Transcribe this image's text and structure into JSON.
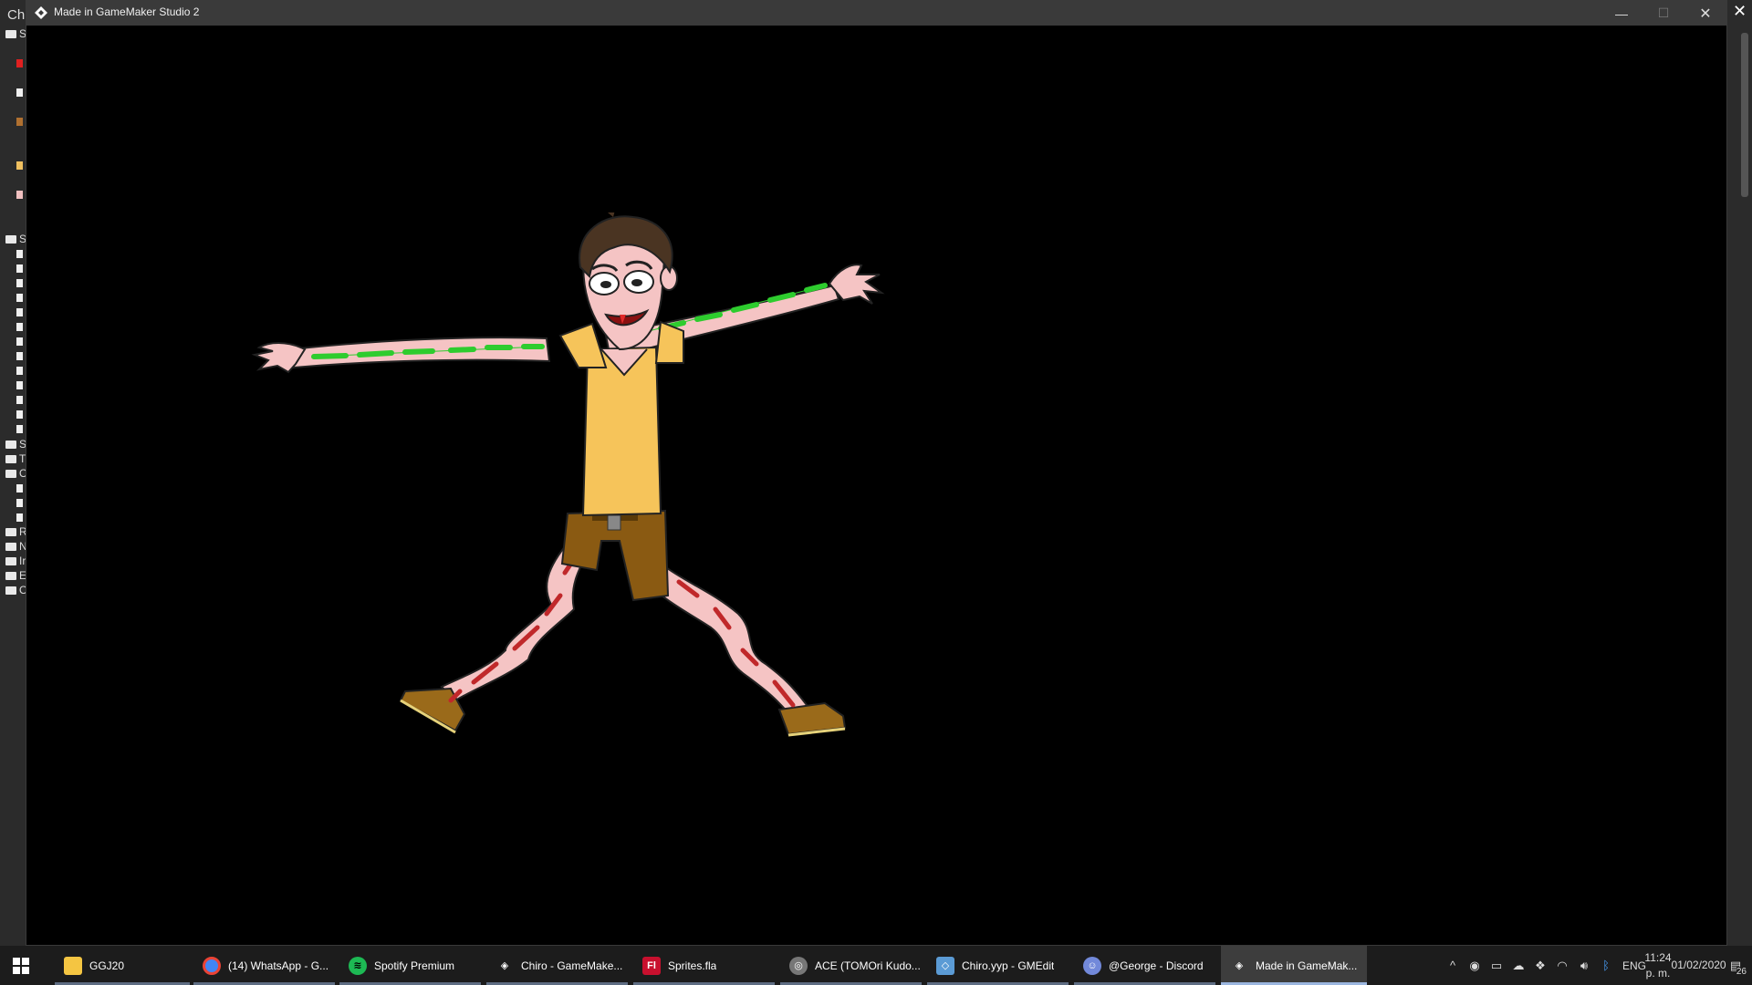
{
  "background_ide": {
    "title_fragment": "Ch",
    "tree_labels": [
      "S",
      "S",
      "S",
      "T",
      "O",
      "R",
      "N",
      "Ir",
      "E",
      "O"
    ]
  },
  "window": {
    "title": "Made in GameMaker Studio 2",
    "controls": {
      "minimize": "—",
      "maximize": "☐",
      "close": "✕"
    }
  },
  "game": {
    "sprite_name": "character",
    "colors": {
      "background": "#000000",
      "skin": "#f5c4c4",
      "shirt": "#f6c45a",
      "shorts": "#8a5a12",
      "hair": "#4a3422",
      "arm_bones": "#2ecc2e",
      "leg_bones": "#c0282a"
    }
  },
  "taskbar": {
    "start_icon": "windows-logo-icon",
    "items": [
      {
        "label": "GGJ20",
        "icon": "folder-icon",
        "color": "#f4c542"
      },
      {
        "label": "(14) WhatsApp - G...",
        "icon": "chrome-icon",
        "color": "#4285f4"
      },
      {
        "label": "Spotify Premium",
        "icon": "spotify-icon",
        "color": "#1db954"
      },
      {
        "label": "Chiro - GameMake...",
        "icon": "gamemaker-icon",
        "color": "#ffffff"
      },
      {
        "label": "Sprites.fla",
        "icon": "flash-icon",
        "color": "#c8102e"
      },
      {
        "label": "ACE (TOMOri Kudo...",
        "icon": "ace-icon",
        "color": "#cccccc"
      },
      {
        "label": "Chiro.yyp - GMEdit",
        "icon": "gmedit-icon",
        "color": "#5b9bd5"
      },
      {
        "label": "@George - Discord",
        "icon": "discord-icon",
        "color": "#7289da"
      },
      {
        "label": "Made in GameMak...",
        "icon": "gamemaker-icon",
        "color": "#ffffff"
      }
    ],
    "active_index": 8,
    "tray": {
      "language": "ENG",
      "time": "11:24 p. m.",
      "date": "01/02/2020",
      "notifications": "26"
    }
  }
}
